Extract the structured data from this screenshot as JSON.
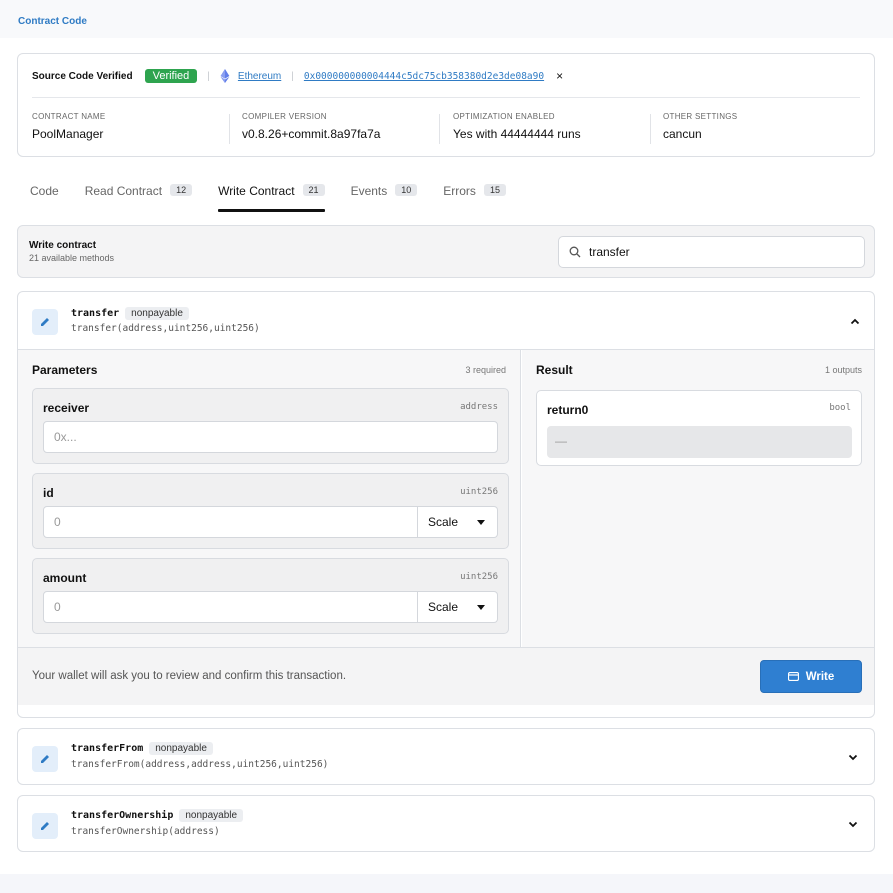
{
  "section_title": "Contract Code",
  "source": {
    "label": "Source Code Verified",
    "verified_badge": "Verified",
    "network": "Ethereum",
    "address": "0x000000000004444c5dc75cb358380d2e3de08a90",
    "close_glyph": "×"
  },
  "meta": [
    {
      "label": "CONTRACT NAME",
      "value": "PoolManager"
    },
    {
      "label": "COMPILER VERSION",
      "value": "v0.8.26+commit.8a97fa7a"
    },
    {
      "label": "OPTIMIZATION ENABLED",
      "value": "Yes with 44444444 runs"
    },
    {
      "label": "OTHER SETTINGS",
      "value": "cancun"
    }
  ],
  "tabs": [
    {
      "label": "Code",
      "count": null
    },
    {
      "label": "Read Contract",
      "count": "12"
    },
    {
      "label": "Write Contract",
      "count": "21"
    },
    {
      "label": "Events",
      "count": "10"
    },
    {
      "label": "Errors",
      "count": "15"
    }
  ],
  "active_tab": "Write Contract",
  "write_header": {
    "title": "Write contract",
    "subtitle": "21 available methods",
    "search_value": "transfer"
  },
  "methods": [
    {
      "name": "transfer",
      "mutability": "nonpayable",
      "signature": "transfer(address,uint256,uint256)",
      "expanded": true,
      "parameters_title": "Parameters",
      "parameters_meta": "3 required",
      "params": [
        {
          "name": "receiver",
          "type": "address",
          "placeholder": "0x..."
        },
        {
          "name": "id",
          "type": "uint256",
          "placeholder": "0",
          "scale": "Scale"
        },
        {
          "name": "amount",
          "type": "uint256",
          "placeholder": "0",
          "scale": "Scale"
        }
      ],
      "result_title": "Result",
      "result_meta": "1 outputs",
      "outputs": [
        {
          "name": "return0",
          "type": "bool",
          "value": "—"
        }
      ],
      "footer_text": "Your wallet will ask you to review and confirm this transaction.",
      "write_label": "Write"
    },
    {
      "name": "transferFrom",
      "mutability": "nonpayable",
      "signature": "transferFrom(address,address,uint256,uint256)",
      "expanded": false
    },
    {
      "name": "transferOwnership",
      "mutability": "nonpayable",
      "signature": "transferOwnership(address)",
      "expanded": false
    }
  ],
  "colors": {
    "accent": "#2f7bc4",
    "verified": "#2ea44f",
    "write_button": "#2f7fd1"
  }
}
